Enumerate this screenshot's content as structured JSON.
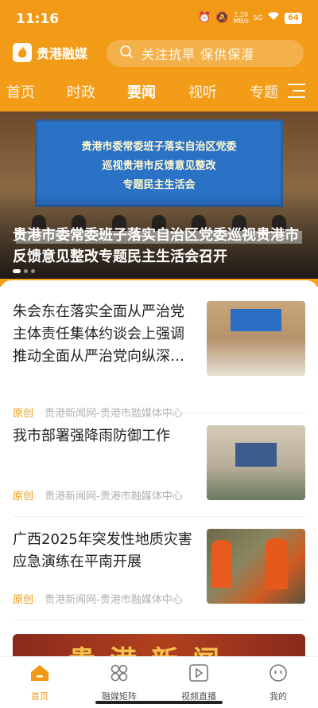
{
  "status_bar": {
    "time": "11:16",
    "network_speed": "1.20",
    "network_speed_unit": "MB/s",
    "signal": "5G",
    "battery": "64"
  },
  "app_bar": {
    "logo_text": "贵港融媒",
    "search_placeholder": "关注抗旱 保供保灌"
  },
  "tabs": [
    {
      "label": "首页"
    },
    {
      "label": "时政"
    },
    {
      "label": "要闻",
      "active": true
    },
    {
      "label": "视听"
    },
    {
      "label": "专题"
    }
  ],
  "banner": {
    "screen_lines": [
      "贵港市委常委班子落实自治区党委",
      "巡视贵港市反馈意见整改",
      "专题民主生活会"
    ],
    "title": "贵港市委常委班子落实自治区党委巡视贵港市反馈意见整改专题民主生活会召开",
    "slide_count": 3,
    "active_slide": 1
  },
  "news": [
    {
      "title": "朱会东在落实全面从严治党主体责任集体约谈会上强调 推动全面从严治党向纵深…",
      "tag": "原创",
      "source": "贵港新闻网-贵港市融媒体中心"
    },
    {
      "title": "我市部署强降雨防御工作",
      "tag": "原创",
      "source": "贵港新闻网-贵港市融媒体中心"
    },
    {
      "title": "广西2025年突发性地质灾害应急演练在平南开展",
      "tag": "原创",
      "source": "贵港新闻网-贵港市融媒体中心"
    }
  ],
  "promo": {
    "text": "贵港新闻"
  },
  "bottom_nav": [
    {
      "label": "首页",
      "icon": "home-icon",
      "active": true
    },
    {
      "label": "融媒矩阵",
      "icon": "grid-icon"
    },
    {
      "label": "视频直播",
      "icon": "play-icon"
    },
    {
      "label": "我的",
      "icon": "user-face-icon"
    }
  ],
  "colors": {
    "accent": "#f29a16",
    "text": "#222222",
    "meta": "#b0b0b0"
  }
}
